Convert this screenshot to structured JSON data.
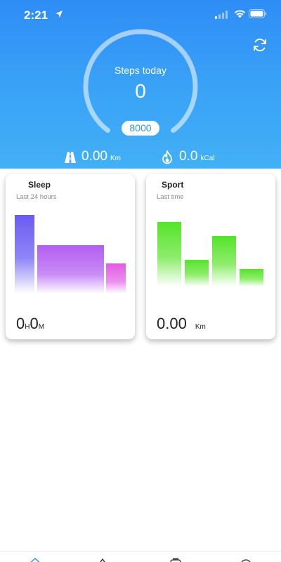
{
  "status_bar": {
    "time": "2:21"
  },
  "steps": {
    "title": "Steps today",
    "value": "0",
    "goal": "8000"
  },
  "metrics": {
    "distance": {
      "value": "0.00",
      "unit": "Km"
    },
    "calories": {
      "value": "0.0",
      "unit": "kCal"
    }
  },
  "sleep_card": {
    "title": "Sleep",
    "subtitle": "Last 24 hours",
    "hours": "0",
    "hours_unit": "H",
    "minutes": "0",
    "minutes_unit": "M"
  },
  "sport_card": {
    "title": "Sport",
    "subtitle": "Last time",
    "value": "0.00",
    "unit": "Km"
  },
  "colors": {
    "header_top": "#2f8df6",
    "header_bottom": "#42b0f6",
    "sleep_bar_1": "#6b5cf3",
    "sleep_bar_2": "#b25df1",
    "sleep_bar_3": "#e35ae6",
    "sport_bar": "#55e32a"
  },
  "icons": [
    "location-arrow-icon",
    "signal-icon",
    "wifi-icon",
    "battery-icon",
    "refresh-icon",
    "road-icon",
    "flame-icon",
    "home-tab-icon",
    "tab-icon-2",
    "tab-icon-3",
    "tab-icon-4"
  ]
}
